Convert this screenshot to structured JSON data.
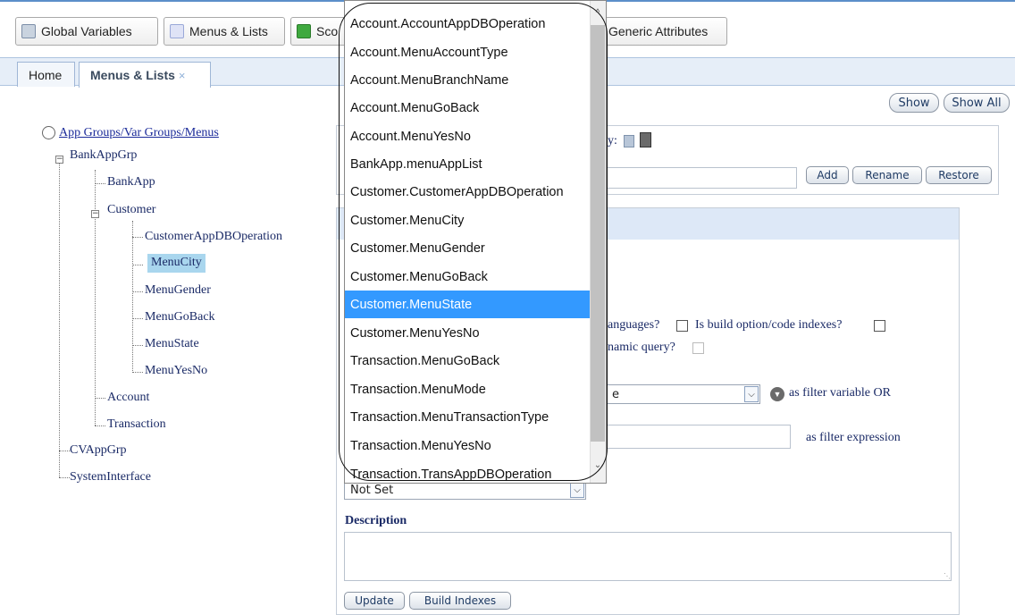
{
  "toolbar": {
    "buttons": [
      {
        "label": "Global Variables",
        "icon": "global-variables-icon",
        "color": "#7d8fa8"
      },
      {
        "label": "Menus & Lists",
        "icon": "menus-lists-icon",
        "color": "#9aa8d8"
      },
      {
        "label": "Sco",
        "icon": "scopes-icon",
        "color": "#3fa93f"
      },
      {
        "label": "Generic Attributes",
        "icon": "generic-attributes-icon",
        "color": "#8aa0bf"
      }
    ]
  },
  "tabs": [
    {
      "label": "Home"
    },
    {
      "label": "Menus & Lists",
      "close": "×"
    }
  ],
  "view_buttons": {
    "show": "Show",
    "show_all": "Show All"
  },
  "tree": {
    "root": "App Groups/Var Groups/Menus",
    "nodes": [
      {
        "label": "BankAppGrp",
        "expander": "−"
      },
      {
        "label": "BankApp"
      },
      {
        "label": "Customer",
        "expander": "−"
      },
      {
        "label": "CustomerAppDBOperation"
      },
      {
        "label": "MenuCity",
        "selected": true
      },
      {
        "label": "MenuGender"
      },
      {
        "label": "MenuGoBack"
      },
      {
        "label": "MenuState"
      },
      {
        "label": "MenuYesNo"
      },
      {
        "label": "Account"
      },
      {
        "label": "Transaction"
      },
      {
        "label": "CVAppGrp"
      },
      {
        "label": "SystemInterface"
      }
    ]
  },
  "panel": {
    "copy_label_fragment": "y:",
    "actions": {
      "add": "Add",
      "rename": "Rename",
      "restore": "Restore"
    },
    "languages_fragment": "anguages?",
    "build_option_label": "Is build option/code indexes?",
    "dynamic_query_fragment": "namic query?",
    "filter_select_fragment": "e",
    "filter_variable_label": "as filter variable OR",
    "filter_expression_label": "as filter expression",
    "not_set_select": "Not Set",
    "description_label": "Description",
    "update_button": "Update",
    "build_indexes_button": "Build Indexes",
    "header_color": "#dde8f7"
  },
  "dropdown": {
    "options": [
      "Account.AccountAppDBOperation",
      "Account.MenuAccountType",
      "Account.MenuBranchName",
      "Account.MenuGoBack",
      "Account.MenuYesNo",
      "BankApp.menuAppList",
      "Customer.CustomerAppDBOperation",
      "Customer.MenuCity",
      "Customer.MenuGender",
      "Customer.MenuGoBack",
      "Customer.MenuState",
      "Customer.MenuYesNo",
      "Transaction.MenuGoBack",
      "Transaction.MenuMode",
      "Transaction.MenuTransactionType",
      "Transaction.MenuYesNo",
      "Transaction.TransAppDBOperation"
    ],
    "selected": "Customer.MenuState",
    "selected_color": "#3399ff"
  }
}
